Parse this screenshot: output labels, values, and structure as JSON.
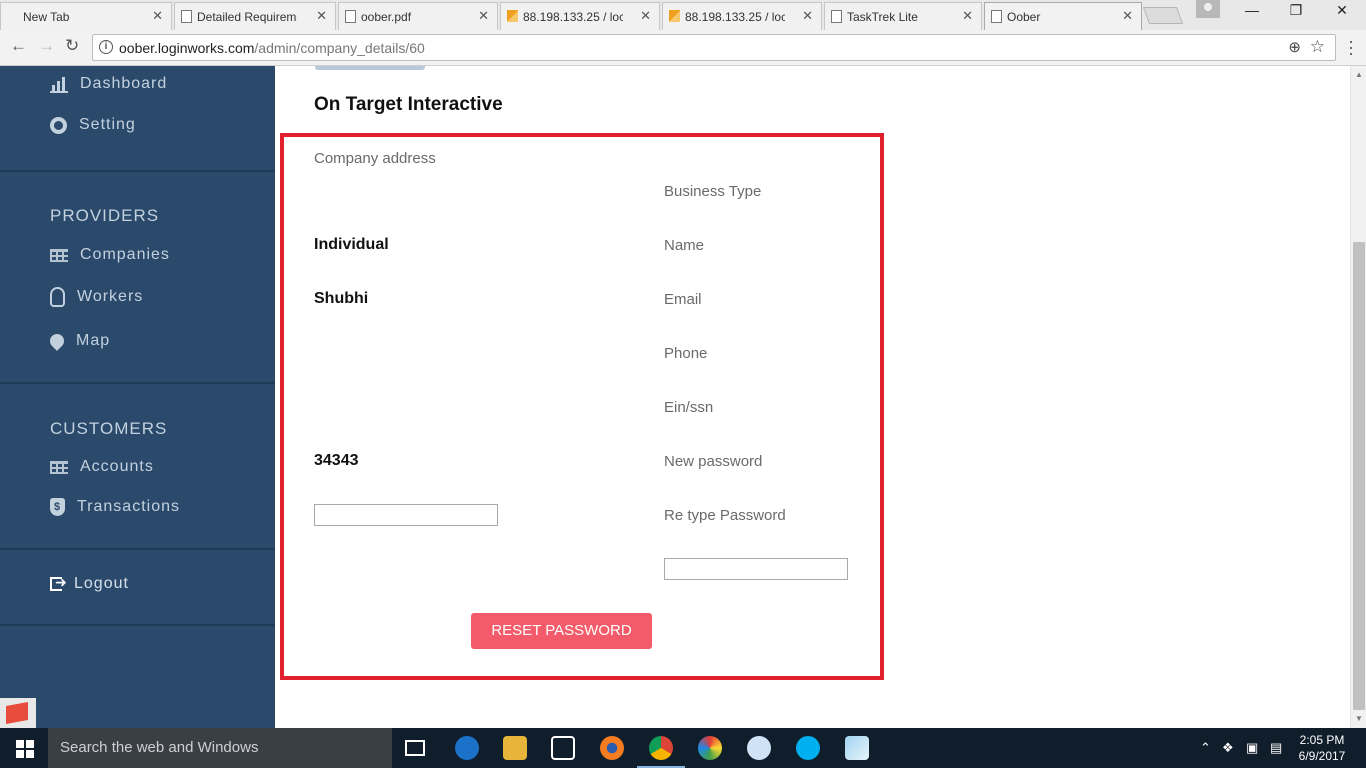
{
  "browser": {
    "tabs": [
      {
        "label": "New Tab",
        "favicon": "page-icon"
      },
      {
        "label": "Detailed Requireme",
        "favicon": "page-icon"
      },
      {
        "label": "oober.pdf",
        "favicon": "page-icon"
      },
      {
        "label": "88.198.133.25 / loc",
        "favicon": "phpmyadmin-icon"
      },
      {
        "label": "88.198.133.25 / loc",
        "favicon": "phpmyadmin-icon"
      },
      {
        "label": "TaskTrek Lite",
        "favicon": "page-icon"
      },
      {
        "label": "Oober",
        "favicon": "page-icon"
      }
    ],
    "active_tab": 6,
    "url_host": "oober.loginworks.com",
    "url_path": "/admin/company_details/60"
  },
  "sidebar": {
    "items_top": [
      {
        "label": "Dashboard",
        "icon": "bar-chart-icon"
      },
      {
        "label": "Setting",
        "icon": "gear-icon"
      }
    ],
    "providers_heading": "PROVIDERS",
    "providers_items": [
      {
        "label": "Companies",
        "icon": "grid-icon"
      },
      {
        "label": "Workers",
        "icon": "user-icon"
      },
      {
        "label": "Map",
        "icon": "map-pin-icon"
      }
    ],
    "customers_heading": "CUSTOMERS",
    "customers_items": [
      {
        "label": "Accounts",
        "icon": "grid-icon"
      },
      {
        "label": "Transactions",
        "icon": "shield-dollar-icon"
      }
    ],
    "logout_label": "Logout",
    "colors": {
      "background": "#2b4a6b",
      "divider": "#1f3a57"
    }
  },
  "company": {
    "name": "On Target Interactive",
    "labels": {
      "company_address": "Company address",
      "business_type": "Business Type",
      "name": "Name",
      "email": "Email",
      "phone": "Phone",
      "ein_ssn": "Ein/ssn",
      "new_password": "New password",
      "retype_password": "Re type Password"
    },
    "values": {
      "business_type": "Individual",
      "name": "Shubhi",
      "ein_ssn": "34343"
    },
    "new_password_value": "",
    "retype_password_value": "",
    "reset_button_label": "RESET PASSWORD",
    "colors": {
      "highlight_border": "#e0202c",
      "reset_button": "#f45b6a"
    }
  },
  "taskbar": {
    "search_placeholder": "Search the web and Windows",
    "time": "2:05 PM",
    "date": "6/9/2017"
  }
}
